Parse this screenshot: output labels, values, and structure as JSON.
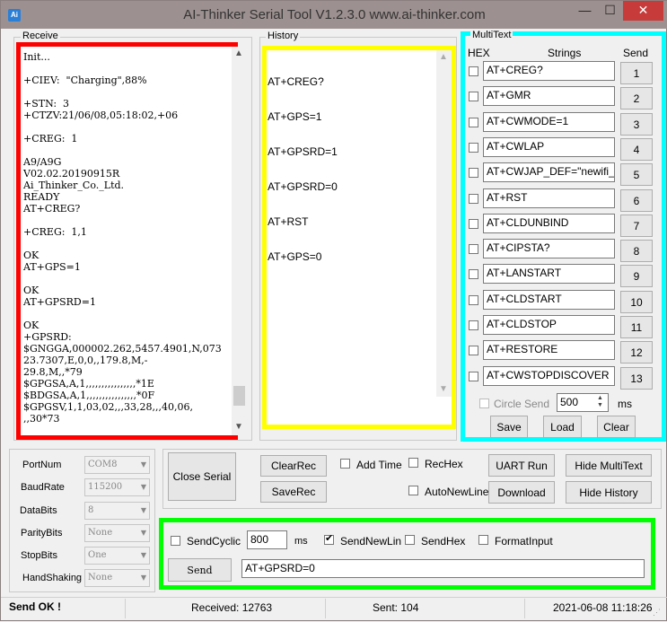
{
  "window": {
    "title": "AI-Thinker Serial Tool V1.2.3.0    www.ai-thinker.com",
    "icon_text": "Ai",
    "minimize": "—",
    "maximize": "☐",
    "close": "✕"
  },
  "receive": {
    "label": "Receive",
    "text": "Init...\n\n+CIEV:  \"Charging\",88%\n\n+STN:  3\n+CTZV:21/06/08,05:18:02,+06\n\n+CREG:  1\n\nA9/A9G\nV02.02.20190915R\nAi_Thinker_Co._Ltd.\nREADY\nAT+CREG?\n\n+CREG:  1,1\n\nOK\nAT+GPS=1\n\nOK\nAT+GPSRD=1\n\nOK\n+GPSRD:\n$GNGGA,000002.262,5457.4901,N,073\n23.7307,E,0,0,,179.8,M,-\n29.8,M,,*79\n$GPGSA,A,1,,,,,,,,,,,,,,,,*1E\n$BDGSA,A,1,,,,,,,,,,,,,,,,*0F\n$GPGSV,1,1,03,02,,,33,28,,,40,06,\n,,30*73"
  },
  "history": {
    "label": "History",
    "items": [
      "AT+CREG?",
      "AT+GPS=1",
      "AT+GPSRD=1",
      "AT+GPSRD=0",
      "AT+RST",
      "AT+GPS=0"
    ]
  },
  "multitext": {
    "label": "MultiText",
    "hex_header": "HEX",
    "strings_header": "Strings",
    "send_header": "Send",
    "rows": [
      {
        "text": "AT+CREG?",
        "num": "1"
      },
      {
        "text": "AT+GMR",
        "num": "2"
      },
      {
        "text": "AT+CWMODE=1",
        "num": "3"
      },
      {
        "text": "AT+CWLAP",
        "num": "4"
      },
      {
        "text": "AT+CWJAP_DEF=\"newifi_",
        "num": "5"
      },
      {
        "text": "AT+RST",
        "num": "6"
      },
      {
        "text": "AT+CLDUNBIND",
        "num": "7"
      },
      {
        "text": "AT+CIPSTA?",
        "num": "8"
      },
      {
        "text": "AT+LANSTART",
        "num": "9"
      },
      {
        "text": "AT+CLDSTART",
        "num": "10"
      },
      {
        "text": "AT+CLDSTOP",
        "num": "11"
      },
      {
        "text": "AT+RESTORE",
        "num": "12"
      },
      {
        "text": "AT+CWSTOPDISCOVER",
        "num": "13"
      }
    ],
    "circle_send": "Circle Send",
    "circle_value": "500",
    "circle_unit": "ms",
    "save": "Save",
    "load": "Load",
    "clear": "Clear"
  },
  "port": {
    "portnum_label": "PortNum",
    "portnum_value": "COM8",
    "baud_label": "BaudRate",
    "baud_value": "115200",
    "databits_label": "DataBits",
    "databits_value": "8",
    "parity_label": "ParityBits",
    "parity_value": "None",
    "stop_label": "StopBits",
    "stop_value": "One",
    "hand_label": "HandShaking",
    "hand_value": "None"
  },
  "controls": {
    "close_serial": "Close Serial",
    "clear_rec": "ClearRec",
    "save_rec": "SaveRec",
    "add_time": "Add Time",
    "rec_hex": "RecHex",
    "auto_newline": "AutoNewLine",
    "uart_run": "UART Run",
    "download": "Download",
    "hide_multitext": "Hide MultiText",
    "hide_history": "Hide History"
  },
  "send": {
    "send_cyclic": "SendCyclic",
    "cyclic_value": "800",
    "cyclic_unit": "ms",
    "send_newline": "SendNewLin",
    "send_hex": "SendHex",
    "format_input": "FormatInput",
    "send_button": "Send",
    "input_value": "AT+GPSRD=0"
  },
  "status": {
    "message": "Send OK !",
    "received": "Received: 12763",
    "sent": "Sent: 104",
    "datetime": "2021-06-08 11:18:26"
  },
  "colors": {
    "receive_highlight": "#ff0000",
    "history_highlight": "#ffff00",
    "multitext_highlight": "#00ffff",
    "send_highlight": "#00ff00",
    "close_button": "#c73b3b"
  }
}
